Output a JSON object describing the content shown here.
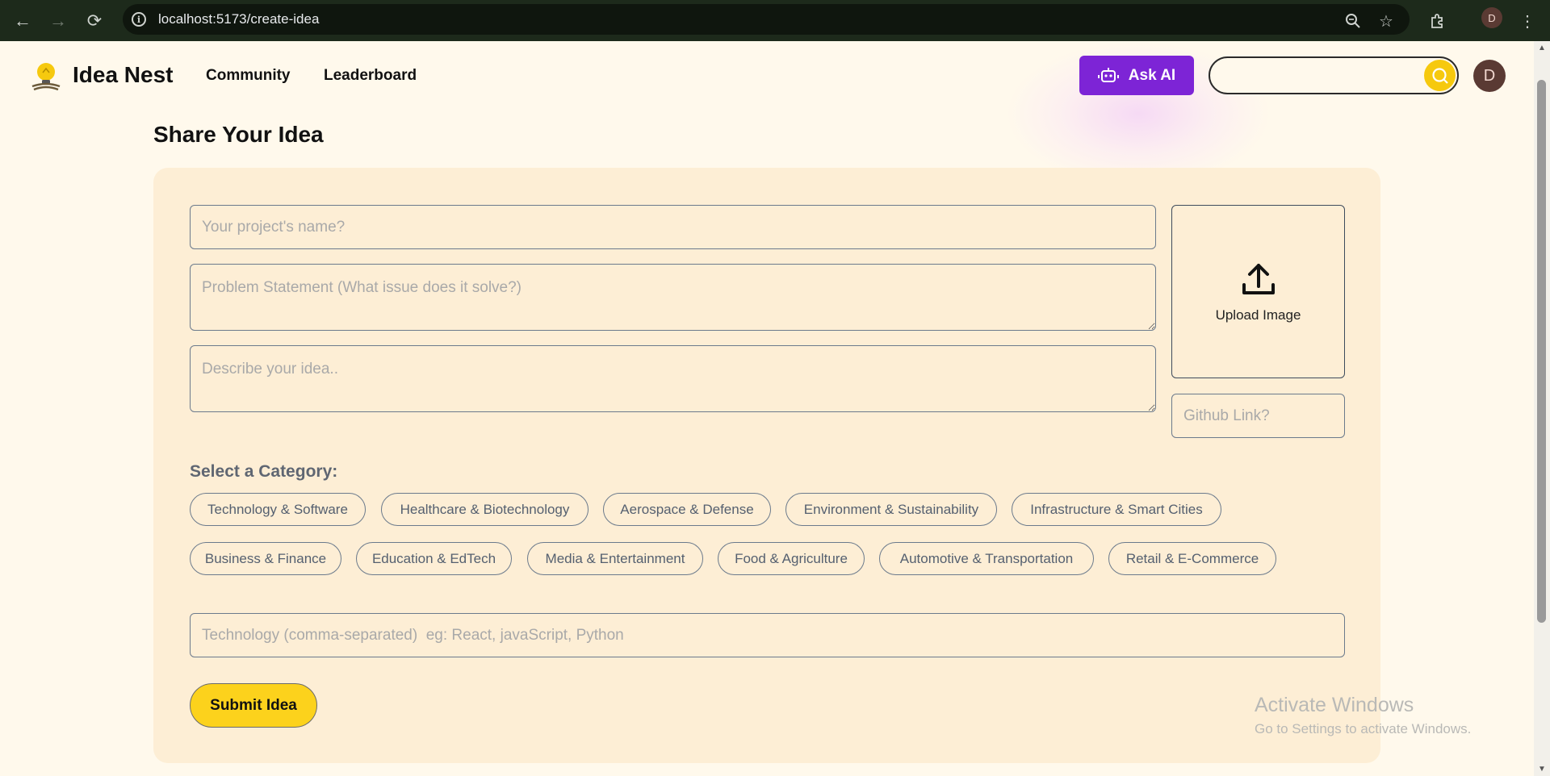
{
  "browser": {
    "url": "localhost:5173/create-idea",
    "profile_initial": "D"
  },
  "header": {
    "brand": "Idea Nest",
    "nav": [
      "Community",
      "Leaderboard"
    ],
    "ask_ai_label": "Ask AI",
    "search_placeholder": "",
    "avatar_initial": "D"
  },
  "page": {
    "title": "Share Your Idea"
  },
  "form": {
    "project_name_placeholder": "Your project's name?",
    "problem_placeholder": "Problem Statement (What issue does it solve?)",
    "description_placeholder": "Describe your idea..",
    "upload_label": "Upload Image",
    "github_placeholder": "Github Link?",
    "category_title": "Select a Category:",
    "categories": [
      "Technology & Software",
      "Healthcare & Biotechnology",
      "Aerospace & Defense",
      "Environment & Sustainability",
      "Infrastructure & Smart Cities",
      "Business & Finance",
      "Education & EdTech",
      "Media & Entertainment",
      "Food & Agriculture",
      "Automotive & Transportation",
      "Retail & E-Commerce"
    ],
    "technology_placeholder": "Technology (comma-separated)  eg: React, javaScript, Python",
    "submit_label": "Submit Idea"
  },
  "watermark": {
    "title": "Activate Windows",
    "subtitle": "Go to Settings to activate Windows."
  },
  "colors": {
    "accent_purple": "#7d24d6",
    "accent_yellow": "#fcd21c",
    "background": "#fff9ec",
    "card": "#fdeed5"
  }
}
